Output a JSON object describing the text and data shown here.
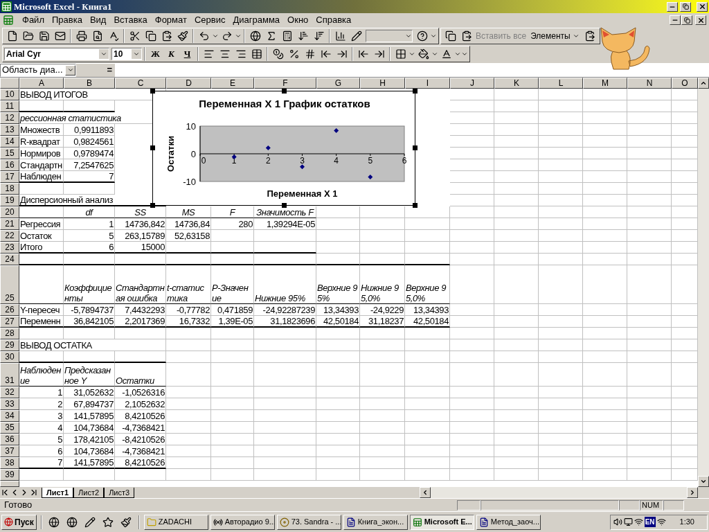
{
  "window": {
    "title": "Microsoft Excel - Книга1"
  },
  "menu": {
    "items": [
      "Файл",
      "Правка",
      "Вид",
      "Вставка",
      "Формат",
      "Сервис",
      "Диаграмма",
      "Окно",
      "Справка"
    ]
  },
  "toolbar": {
    "paste_all": {
      "label": "Вставить все",
      "disabled": true
    },
    "elements": "Элементы"
  },
  "format_toolbar": {
    "font": "Arial Cyr",
    "size": "10",
    "bold": "Ж",
    "italic": "К",
    "underline": "Ч"
  },
  "formula_bar": {
    "name_box": "Область диа...",
    "equals": "="
  },
  "sheet": {
    "columns": [
      "A",
      "B",
      "C",
      "D",
      "E",
      "F",
      "G",
      "H",
      "I",
      "J",
      "K",
      "L",
      "M",
      "N",
      "O"
    ],
    "rows": [
      {
        "number": "10",
        "cells": [
          {
            "text": "ВЫВОД ИТОГОВ"
          }
        ]
      },
      {
        "number": "11",
        "cells": []
      },
      {
        "number": "12",
        "cells": [
          {
            "text": "рессионная статистика",
            "italic": true
          }
        ]
      },
      {
        "number": "13",
        "cells": [
          {
            "text": "Множеств"
          },
          {
            "text": "0,9911893",
            "numeric": true
          }
        ]
      },
      {
        "number": "14",
        "cells": [
          {
            "text": "R-квадрат"
          },
          {
            "text": "0,9824561",
            "numeric": true
          }
        ]
      },
      {
        "number": "15",
        "cells": [
          {
            "text": "Нормиров"
          },
          {
            "text": "0,9789474",
            "numeric": true
          }
        ]
      },
      {
        "number": "16",
        "cells": [
          {
            "text": "Стандартн"
          },
          {
            "text": "7,2547625",
            "numeric": true
          }
        ]
      },
      {
        "number": "17",
        "cells": [
          {
            "text": "Наблюден"
          },
          {
            "text": "7",
            "numeric": true
          }
        ]
      },
      {
        "number": "18",
        "cells": []
      },
      {
        "number": "19",
        "cells": [
          {
            "text": "Дисперсионный анализ"
          }
        ]
      },
      {
        "number": "20",
        "cells": [
          null,
          {
            "text": "df",
            "italic": true,
            "centered": true
          },
          {
            "text": "SS",
            "italic": true,
            "centered": true
          },
          {
            "text": "MS",
            "italic": true,
            "centered": true
          },
          {
            "text": "F",
            "italic": true,
            "centered": true
          },
          {
            "text": "Значимость F",
            "italic": true,
            "centered": true
          }
        ]
      },
      {
        "number": "21",
        "cells": [
          {
            "text": "Регрессия"
          },
          {
            "text": "1",
            "numeric": true
          },
          {
            "text": "14736,842",
            "numeric": true
          },
          {
            "text": "14736,84",
            "numeric": true
          },
          {
            "text": "280",
            "numeric": true
          },
          {
            "text": "1,39294E-05",
            "numeric": true
          }
        ]
      },
      {
        "number": "22",
        "cells": [
          {
            "text": "Остаток"
          },
          {
            "text": "5",
            "numeric": true
          },
          {
            "text": "263,15789",
            "numeric": true
          },
          {
            "text": "52,63158",
            "numeric": true
          }
        ]
      },
      {
        "number": "23",
        "cells": [
          {
            "text": "Итого"
          },
          {
            "text": "6",
            "numeric": true
          },
          {
            "text": "15000",
            "numeric": true
          }
        ]
      },
      {
        "number": "24",
        "cells": []
      },
      {
        "number": "25",
        "cells": [
          null,
          {
            "text": "Коэффициенты",
            "italic": true
          },
          {
            "text": "Стандартная ошибка",
            "italic": true
          },
          {
            "text": "t-статистика",
            "italic": true
          },
          {
            "text": "P-Значение",
            "italic": true
          },
          {
            "text": "Нижние 95%",
            "italic": true
          },
          {
            "text": "Верхние 95%",
            "italic": true
          },
          {
            "text": "Нижние 95,0%",
            "italic": true
          },
          {
            "text": "Верхние 95,0%",
            "italic": true
          }
        ]
      },
      {
        "number": "26",
        "cells": [
          {
            "text": "Y-пересеч"
          },
          {
            "text": "-5,7894737",
            "numeric": true
          },
          {
            "text": "7,4432293",
            "numeric": true
          },
          {
            "text": "-0,77782",
            "numeric": true
          },
          {
            "text": "0,471859",
            "numeric": true
          },
          {
            "text": "-24,92287239",
            "numeric": true
          },
          {
            "text": "13,34393",
            "numeric": true
          },
          {
            "text": "-24,9229",
            "numeric": true
          },
          {
            "text": "13,34393",
            "numeric": true
          }
        ]
      },
      {
        "number": "27",
        "cells": [
          {
            "text": "Переменн"
          },
          {
            "text": "36,842105",
            "numeric": true
          },
          {
            "text": "2,2017369",
            "numeric": true
          },
          {
            "text": "16,7332",
            "numeric": true
          },
          {
            "text": "1,39E-05",
            "numeric": true
          },
          {
            "text": "31,1823696",
            "numeric": true
          },
          {
            "text": "42,50184",
            "numeric": true
          },
          {
            "text": "31,18237",
            "numeric": true
          },
          {
            "text": "42,50184",
            "numeric": true
          }
        ]
      },
      {
        "number": "28",
        "cells": []
      },
      {
        "number": "29",
        "cells": [
          {
            "text": "ВЫВОД ОСТАТКА"
          }
        ]
      },
      {
        "number": "30",
        "cells": []
      },
      {
        "number": "31",
        "cells": [
          {
            "text": "Наблюдение",
            "italic": true
          },
          {
            "text": "Предсказанное Y",
            "italic": true
          },
          {
            "text": "Остатки",
            "italic": true
          }
        ]
      },
      {
        "number": "32",
        "cells": [
          {
            "text": "1",
            "numeric": true
          },
          {
            "text": "31,052632",
            "numeric": true
          },
          {
            "text": "-1,0526316",
            "numeric": true
          }
        ]
      },
      {
        "number": "33",
        "cells": [
          {
            "text": "2",
            "numeric": true
          },
          {
            "text": "67,894737",
            "numeric": true
          },
          {
            "text": "2,1052632",
            "numeric": true
          }
        ]
      },
      {
        "number": "34",
        "cells": [
          {
            "text": "3",
            "numeric": true
          },
          {
            "text": "141,57895",
            "numeric": true
          },
          {
            "text": "8,4210526",
            "numeric": true
          }
        ]
      },
      {
        "number": "35",
        "cells": [
          {
            "text": "4",
            "numeric": true
          },
          {
            "text": "104,73684",
            "numeric": true
          },
          {
            "text": "-4,7368421",
            "numeric": true
          }
        ]
      },
      {
        "number": "36",
        "cells": [
          {
            "text": "5",
            "numeric": true
          },
          {
            "text": "178,42105",
            "numeric": true
          },
          {
            "text": "-8,4210526",
            "numeric": true
          }
        ]
      },
      {
        "number": "37",
        "cells": [
          {
            "text": "6",
            "numeric": true
          },
          {
            "text": "104,73684",
            "numeric": true
          },
          {
            "text": "-4,7368421",
            "numeric": true
          }
        ]
      },
      {
        "number": "38",
        "cells": [
          {
            "text": "7",
            "numeric": true
          },
          {
            "text": "141,57895",
            "numeric": true
          },
          {
            "text": "8,4210526",
            "numeric": true
          }
        ]
      },
      {
        "number": "39",
        "cells": []
      }
    ]
  },
  "chart": {
    "selected": true,
    "chart_data": {
      "type": "scatter",
      "title": "Переменная X 1 График остатков",
      "xlabel": "Переменная X 1",
      "ylabel": "Остатки",
      "x": [
        1,
        2,
        3,
        4,
        5
      ],
      "series": [
        {
          "color": "#000080",
          "values": [
            -1.1,
            2.1,
            -4.7,
            8.4,
            -8.4
          ]
        }
      ],
      "xlim": [
        0,
        6
      ],
      "ylim": [
        -10,
        10
      ],
      "xticks": [
        0,
        1,
        2,
        3,
        4,
        5,
        6
      ],
      "yticks": [
        -10,
        0,
        10
      ]
    }
  },
  "sheet_tabs": [
    {
      "label": "Лист1",
      "selected": true
    },
    {
      "label": "Лист2",
      "selected": false
    },
    {
      "label": "Лист3",
      "selected": false
    }
  ],
  "status_bar": {
    "text": "Готово",
    "indicator": "NUM"
  },
  "taskbar": {
    "start": "Пуск",
    "tasks": [
      {
        "label": "ZADACHI",
        "kind": "folder",
        "selected": false
      },
      {
        "label": "Авторадио 9...",
        "kind": "radio",
        "selected": false
      },
      {
        "label": "73. Sandra - ...",
        "kind": "player",
        "selected": false
      },
      {
        "label": "Книга_экон...",
        "kind": "word",
        "selected": false
      },
      {
        "label": "Microsoft E...",
        "kind": "excel",
        "selected": true
      },
      {
        "label": "Метод_заоч...",
        "kind": "word",
        "selected": false
      }
    ],
    "language": "EN",
    "clock": "1:30"
  }
}
